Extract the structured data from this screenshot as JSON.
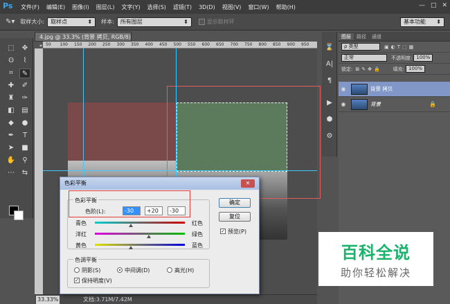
{
  "app": {
    "logo": "Ps"
  },
  "menu": [
    "文件(F)",
    "编辑(E)",
    "图像(I)",
    "图层(L)",
    "文字(Y)",
    "选择(S)",
    "滤镜(T)",
    "3D(D)",
    "视图(V)",
    "窗口(W)",
    "帮助(H)"
  ],
  "window_buttons": [
    "—",
    "□",
    "✕"
  ],
  "options": {
    "sample_size_label": "取样大小:",
    "sample_size_value": "取样点",
    "sample_label": "样本:",
    "sample_value": "所有图层",
    "show_ring_label": "显示取样环",
    "workspace": "基本功能"
  },
  "document": {
    "tab_title": "4.jpg @ 33.3% (背景 拷贝, RGB/8) *",
    "zoom": "33.33%",
    "info": "文档:3.71M/7.42M"
  },
  "ruler_ticks": [
    "50",
    "100",
    "150",
    "200",
    "250",
    "300",
    "350",
    "400",
    "450",
    "500",
    "550",
    "600",
    "650",
    "700",
    "750",
    "800",
    "850",
    "900",
    "950"
  ],
  "layers_panel": {
    "tabs": [
      "图层",
      "路径",
      "通道"
    ],
    "kind_label": "ρ 类型",
    "blend_mode": "正常",
    "opacity_label": "不透明度:",
    "opacity_value": "100%",
    "lock_label": "锁定:",
    "fill_label": "填充:",
    "fill_value": "100%",
    "layers": [
      {
        "name": "背景 拷贝",
        "selected": true
      },
      {
        "name": "背景",
        "selected": false
      }
    ]
  },
  "dialog": {
    "title": "色彩平衡",
    "balance_group": "色彩平衡",
    "levels_label": "色阶(L):",
    "levels": [
      "-30",
      "+20",
      "-30"
    ],
    "sliders": [
      {
        "left": "青色",
        "right": "红色",
        "position": 0.4
      },
      {
        "left": "洋红",
        "right": "绿色",
        "position": 0.6
      },
      {
        "left": "黄色",
        "right": "蓝色",
        "position": 0.4
      }
    ],
    "tone_group": "色调平衡",
    "tones": [
      "阴影(S)",
      "中间调(D)",
      "高光(H)"
    ],
    "selected_tone": 1,
    "preserve_label": "保持明度(V)",
    "ok_label": "确定",
    "reset_label": "复位",
    "preview_label": "预览(P)"
  },
  "watermark": {
    "title": "百科全说",
    "subtitle": "助你轻松解决"
  }
}
